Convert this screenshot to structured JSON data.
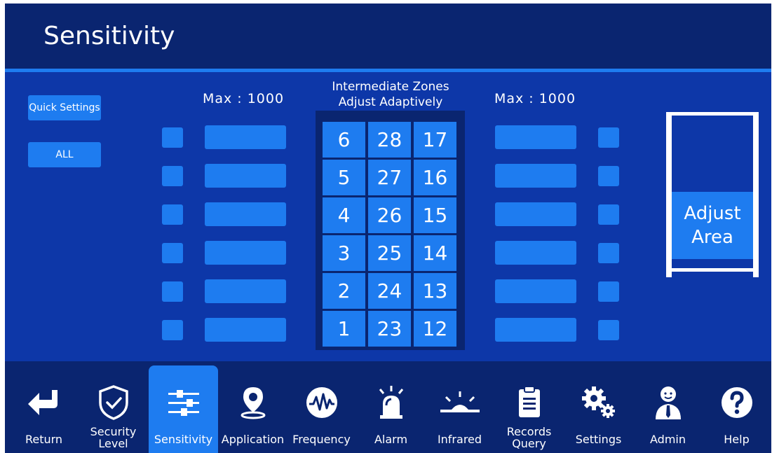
{
  "title": "Sensitivity",
  "quick_settings_label": "Quick Settings",
  "all_label": "ALL",
  "left_max_label": "Max : 1000",
  "right_max_label": "Max : 1000",
  "zone_title_line1": "Intermediate Zones",
  "zone_title_line2": "Adjust Adaptively",
  "zones": [
    [
      "6",
      "28",
      "17"
    ],
    [
      "5",
      "27",
      "16"
    ],
    [
      "4",
      "26",
      "15"
    ],
    [
      "3",
      "25",
      "14"
    ],
    [
      "2",
      "24",
      "13"
    ],
    [
      "1",
      "23",
      "12"
    ]
  ],
  "adjust_area_line1": "Adjust",
  "adjust_area_line2": "Area",
  "colors": {
    "accent": "#1e7cf0",
    "header": "#0a2570",
    "panel": "#0d37a8"
  },
  "nav": [
    {
      "label": "Return",
      "icon": "return-icon"
    },
    {
      "label1": "Security",
      "label2": "Level",
      "icon": "shield-check-icon"
    },
    {
      "label": "Sensitivity",
      "icon": "sliders-icon",
      "active": true
    },
    {
      "label": "Application",
      "icon": "location-pin-icon"
    },
    {
      "label": "Frequency",
      "icon": "waveform-icon"
    },
    {
      "label": "Alarm",
      "icon": "siren-icon"
    },
    {
      "label": "Infrared",
      "icon": "infrared-icon"
    },
    {
      "label1": "Records",
      "label2": "Query",
      "icon": "clipboard-icon"
    },
    {
      "label": "Settings",
      "icon": "gears-icon"
    },
    {
      "label": "Admin",
      "icon": "admin-person-icon"
    },
    {
      "label": "Help",
      "icon": "help-icon"
    }
  ]
}
